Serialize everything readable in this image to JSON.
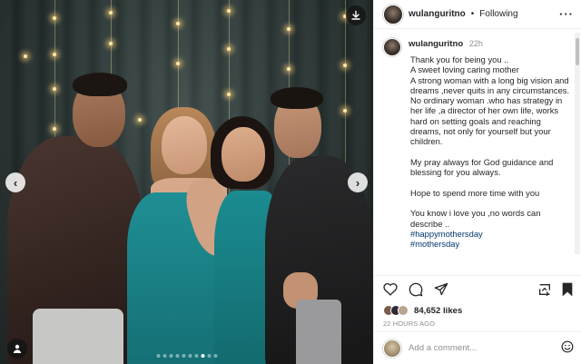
{
  "post": {
    "username": "wulanguritno",
    "separator": "•",
    "follow_status": "Following",
    "more_glyph": "···",
    "caption": {
      "time": "22h",
      "text": "Thank you for being you ..\nA sweet loving caring mother\nA strong woman with a long big vision and dreams ,never quits in any circumstances.\nNo ordinary woman .who has strategy in her life ,a director of her own life, works hard on setting goals and reaching dreams, not only for yourself but your children.\n\nMy pray always for God guidance  and blessing for you always.\n\nHope to spend more time with you\n\nYou know i love you ,no words can describe ..",
      "hashtags": "#happymothersday\n#mothersday"
    },
    "likes": "84,652 likes",
    "time_ago": "22 HOURS AGO",
    "comment_placeholder": "Add a comment...",
    "media": {
      "prev_glyph": "‹",
      "next_glyph": "›",
      "carousel_count": 10,
      "carousel_active": 8
    },
    "icons": {
      "like": "heart-icon",
      "comment": "comment-icon",
      "share": "share-icon",
      "repost": "repost-icon",
      "save": "bookmark-icon",
      "emoji": "smiley-icon",
      "tag": "person-tag-icon",
      "download": "download-icon"
    },
    "colors": {
      "text": "#262626",
      "muted": "#8e8e8e",
      "hashtag": "#00376b",
      "border": "#efefef",
      "dress": "#1d8a8e"
    }
  }
}
